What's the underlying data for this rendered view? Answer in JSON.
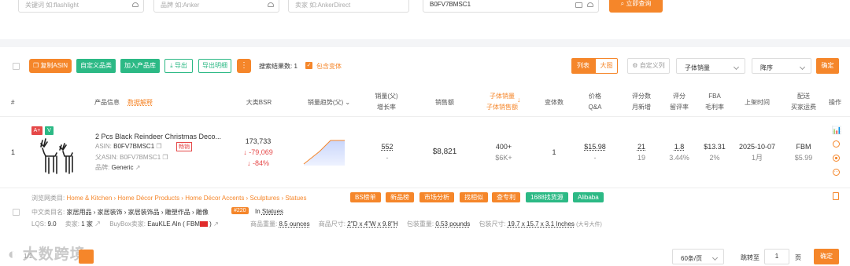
{
  "search": {
    "keyword_placeholder": "关键词 如:flashlight",
    "brand_placeholder": "品牌 如:Anker",
    "seller_placeholder": "卖家 如:AnkerDirect",
    "asin_value": "B0FV7BMSC1",
    "query_button": "立即查询"
  },
  "toolbar": {
    "copy_asin": "复制ASIN",
    "custom_category": "自定义品类",
    "add_library": "加入产品库",
    "export": "导出",
    "export_detail": "导出明细",
    "more": "⋮",
    "result_label": "搜索结果数:",
    "result_count": "1",
    "include_variants": "包含变体",
    "view_list": "列表",
    "view_grid": "大图",
    "custom_columns": "自定义列",
    "sort_field": "子体销量",
    "sort_order": "降序",
    "confirm": "确定"
  },
  "columns": {
    "index": "#",
    "product_info": "产品信息",
    "data_explain": "数据解释",
    "bsr": "大类BSR",
    "sales_trend": "销量趋势(父)",
    "sales_parent": "销量(父)",
    "growth": "增长率",
    "revenue": "销售额",
    "child_sales": "子体销量",
    "child_revenue": "子体销售额",
    "variants": "变体数",
    "price": "价格",
    "qa": "Q&A",
    "ratings": "评分数",
    "monthly_new": "月新增",
    "rating": "评分",
    "review_rate": "留评率",
    "fba": "FBA",
    "margin": "毛利率",
    "listed": "上架时间",
    "delivery": "配送",
    "buyer_shipping": "买家运费",
    "action": "操作"
  },
  "row": {
    "index": "1",
    "badge_a": "A+",
    "badge_v": "V",
    "title": "2 Pcs Black Reindeer Christmas Deco...",
    "asin_label": "ASIN:",
    "asin": "B0FV7BMSC1",
    "bestseller_tag": "畅销",
    "parent_asin_label": "父ASIN:",
    "parent_asin": "B0FV7BMSC1",
    "brand_label": "品牌:",
    "brand": "Generic",
    "bsr": "173,733",
    "bsr_change": "↓ -79,069",
    "bsr_pct": "↓ -84%",
    "sales": "552",
    "growth": "-",
    "revenue": "$8,821",
    "child_sales": "400+",
    "child_revenue": "$6K+",
    "variants": "1",
    "price": "$15.98",
    "qa": "-",
    "ratings": "21",
    "monthly_new": "19",
    "rating": "1.8",
    "review_rate": "3.44%",
    "fba": "$13.31",
    "margin": "2%",
    "listed_date": "2025-10-07",
    "listed_age": "1月",
    "delivery": "FBM",
    "shipping": "$5.99"
  },
  "detail": {
    "browse_label": "浏览网类目:",
    "browse_path": "Home & Kitchen › Home Décor Products › Home Décor Accents › Sculptures › Statues",
    "tags": [
      "BS榜单",
      "新品榜",
      "市场分析",
      "找相似",
      "查专利",
      "1688找货源",
      "Alibaba"
    ],
    "cn_label": "中文类目名:",
    "cn_path": "家居用品 › 家居装饰 › 家居装饰品 › 雕塑作品 › 雕像",
    "rank_badge": "#220",
    "rank_in": "In",
    "rank_category": "Statues",
    "lqs_label": "LQS:",
    "lqs": "9.0",
    "sellers_label": "卖家:",
    "sellers": "1 家",
    "buybox_label": "BuyBox卖家:",
    "buybox": "EauKLE Aln ( FBM",
    "weight_label": "商品重量:",
    "weight": "8.5 ounces",
    "dim_label": "商品尺寸:",
    "dim": "2\"D x 4\"W x 9.8\"H",
    "pkg_weight_label": "包装重量:",
    "pkg_weight": "0.53 pounds",
    "pkg_dim_label": "包装尺寸:",
    "pkg_dim": "19.7 x 15.7 x 3.1 Inches",
    "pkg_size_class": "(大号大件)"
  },
  "pager": {
    "page_info": "1/1",
    "per_page": "60条/页",
    "jump_label": "跳转至",
    "jump_value": "1",
    "page_unit": "页",
    "confirm": "确定",
    "watermark": "大数跨境"
  },
  "colors": {
    "accent": "#f5862a",
    "green": "#2cb985",
    "red": "#e54848"
  }
}
